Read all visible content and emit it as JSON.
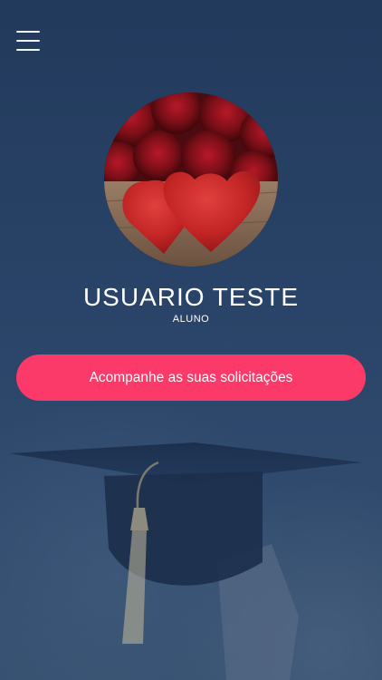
{
  "header": {
    "menu_icon": "hamburger-menu-icon"
  },
  "profile": {
    "avatar_description": "avatar-photo",
    "name": "USUARIO TESTE",
    "role": "ALUNO"
  },
  "actions": {
    "primary_label": "Acompanhe as suas solicitações"
  },
  "colors": {
    "accent": "#fb3a6a",
    "background": "#2a4266",
    "text": "#ffffff"
  }
}
